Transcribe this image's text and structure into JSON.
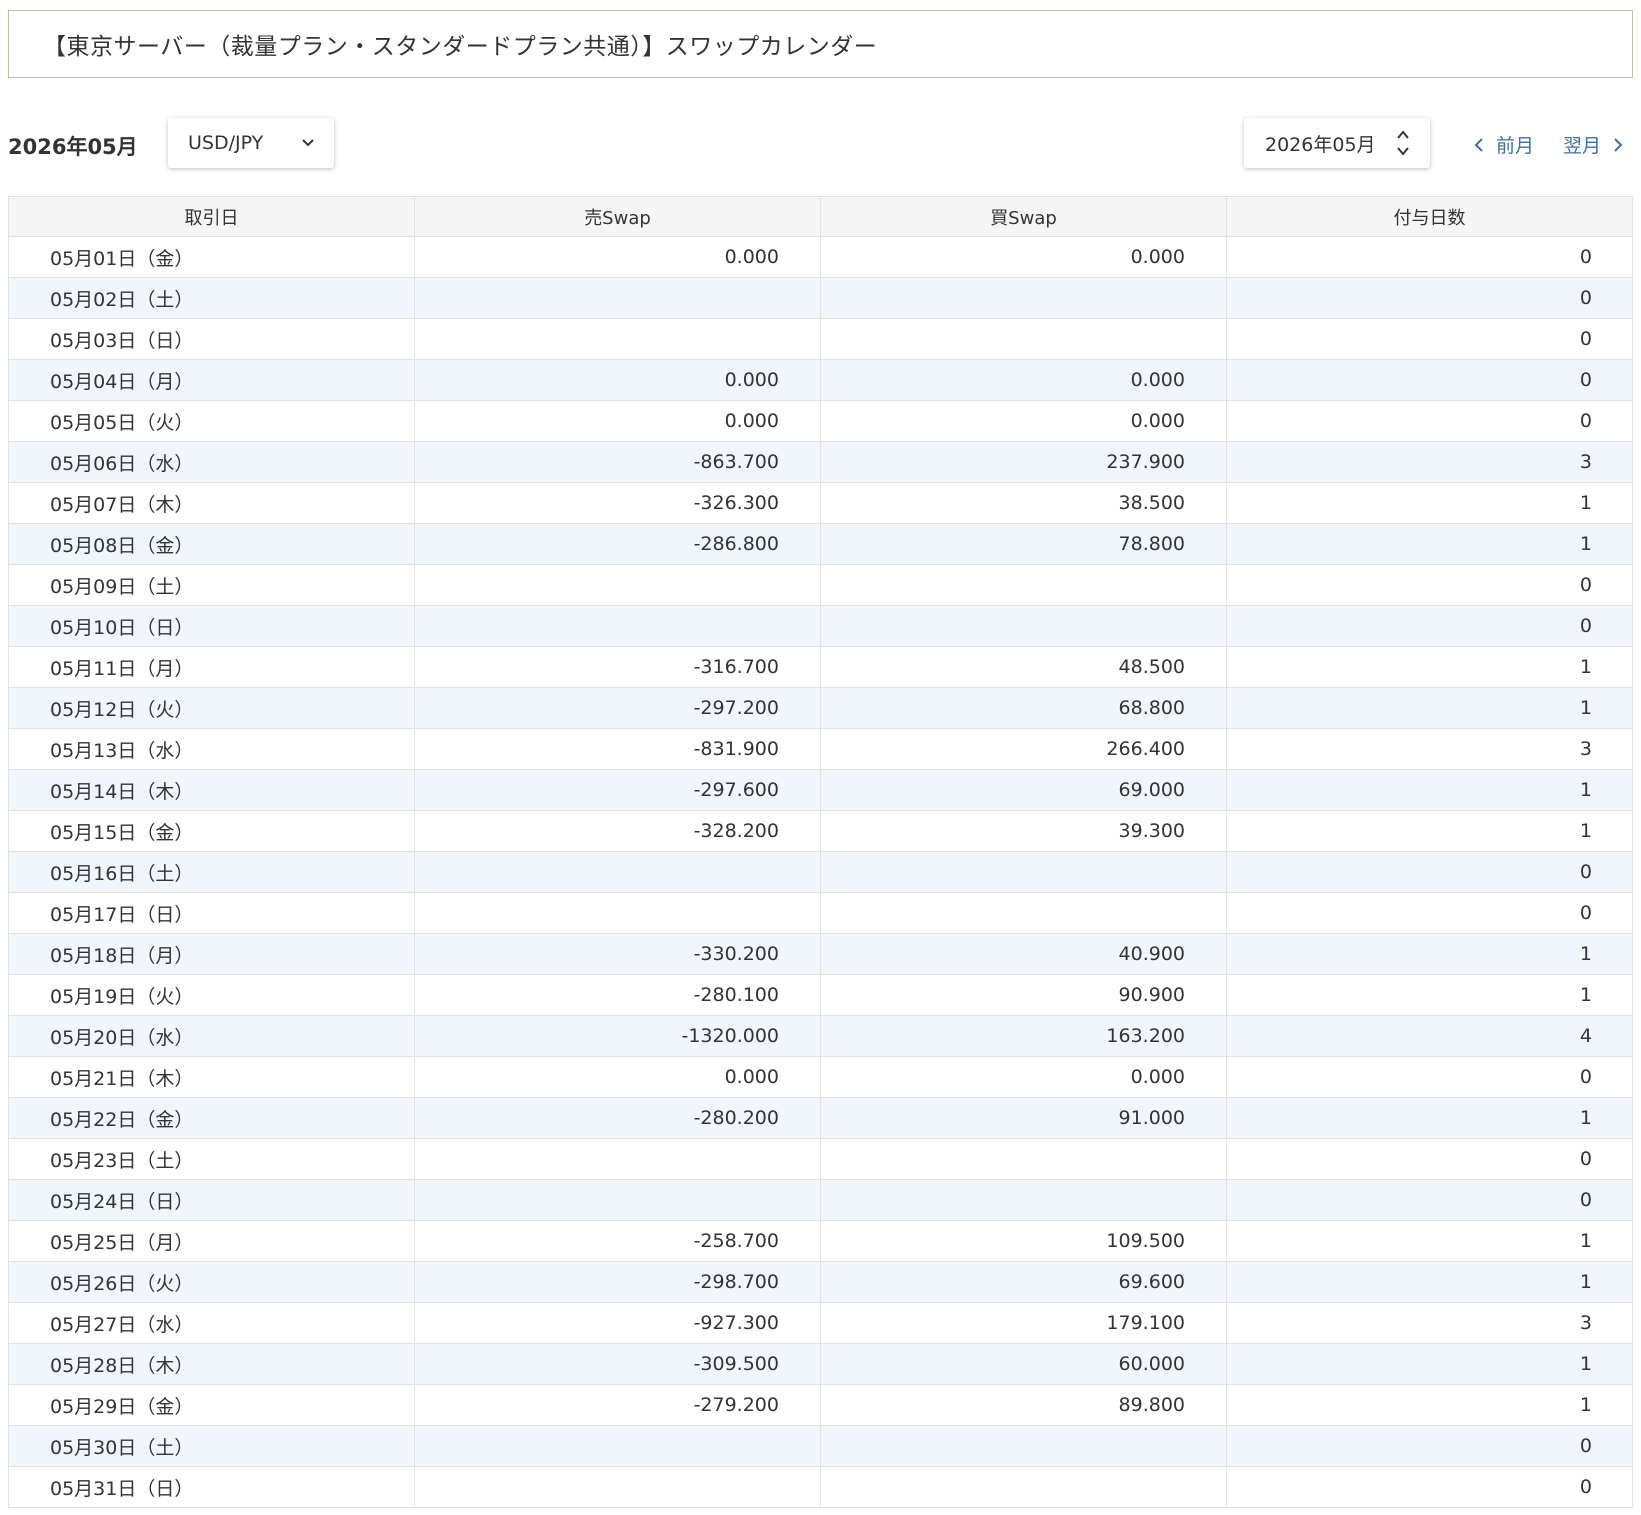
{
  "title": "【東京サーバー（裁量プラン・スタンダードプラン共通）】スワップカレンダー",
  "toolbar": {
    "month_label": "2026年05月",
    "pair_selected": "USD/JPY",
    "month_selected": "2026年05月",
    "prev_label": "前月",
    "next_label": "翌月"
  },
  "icons": {
    "pair_select": "chevron-down-icon",
    "month_select": "up-down-chevron-icon",
    "prev": "chevron-left-icon",
    "next": "chevron-right-icon"
  },
  "colors": {
    "title_border": "#b9c0a3",
    "header_bg": "#f5f5f5",
    "alt_row_bg": "#f1f6fc",
    "link": "#3f6f9f"
  },
  "table": {
    "headers": [
      "取引日",
      "売Swap",
      "買Swap",
      "付与日数"
    ],
    "rows": [
      {
        "date": "05月01日（金）",
        "sell": "0.000",
        "buy": "0.000",
        "days": "0"
      },
      {
        "date": "05月02日（土）",
        "sell": "",
        "buy": "",
        "days": "0"
      },
      {
        "date": "05月03日（日）",
        "sell": "",
        "buy": "",
        "days": "0"
      },
      {
        "date": "05月04日（月）",
        "sell": "0.000",
        "buy": "0.000",
        "days": "0"
      },
      {
        "date": "05月05日（火）",
        "sell": "0.000",
        "buy": "0.000",
        "days": "0"
      },
      {
        "date": "05月06日（水）",
        "sell": "-863.700",
        "buy": "237.900",
        "days": "3"
      },
      {
        "date": "05月07日（木）",
        "sell": "-326.300",
        "buy": "38.500",
        "days": "1"
      },
      {
        "date": "05月08日（金）",
        "sell": "-286.800",
        "buy": "78.800",
        "days": "1"
      },
      {
        "date": "05月09日（土）",
        "sell": "",
        "buy": "",
        "days": "0"
      },
      {
        "date": "05月10日（日）",
        "sell": "",
        "buy": "",
        "days": "0"
      },
      {
        "date": "05月11日（月）",
        "sell": "-316.700",
        "buy": "48.500",
        "days": "1"
      },
      {
        "date": "05月12日（火）",
        "sell": "-297.200",
        "buy": "68.800",
        "days": "1"
      },
      {
        "date": "05月13日（水）",
        "sell": "-831.900",
        "buy": "266.400",
        "days": "3"
      },
      {
        "date": "05月14日（木）",
        "sell": "-297.600",
        "buy": "69.000",
        "days": "1"
      },
      {
        "date": "05月15日（金）",
        "sell": "-328.200",
        "buy": "39.300",
        "days": "1"
      },
      {
        "date": "05月16日（土）",
        "sell": "",
        "buy": "",
        "days": "0"
      },
      {
        "date": "05月17日（日）",
        "sell": "",
        "buy": "",
        "days": "0"
      },
      {
        "date": "05月18日（月）",
        "sell": "-330.200",
        "buy": "40.900",
        "days": "1"
      },
      {
        "date": "05月19日（火）",
        "sell": "-280.100",
        "buy": "90.900",
        "days": "1"
      },
      {
        "date": "05月20日（水）",
        "sell": "-1320.000",
        "buy": "163.200",
        "days": "4"
      },
      {
        "date": "05月21日（木）",
        "sell": "0.000",
        "buy": "0.000",
        "days": "0"
      },
      {
        "date": "05月22日（金）",
        "sell": "-280.200",
        "buy": "91.000",
        "days": "1"
      },
      {
        "date": "05月23日（土）",
        "sell": "",
        "buy": "",
        "days": "0"
      },
      {
        "date": "05月24日（日）",
        "sell": "",
        "buy": "",
        "days": "0"
      },
      {
        "date": "05月25日（月）",
        "sell": "-258.700",
        "buy": "109.500",
        "days": "1"
      },
      {
        "date": "05月26日（火）",
        "sell": "-298.700",
        "buy": "69.600",
        "days": "1"
      },
      {
        "date": "05月27日（水）",
        "sell": "-927.300",
        "buy": "179.100",
        "days": "3"
      },
      {
        "date": "05月28日（木）",
        "sell": "-309.500",
        "buy": "60.000",
        "days": "1"
      },
      {
        "date": "05月29日（金）",
        "sell": "-279.200",
        "buy": "89.800",
        "days": "1"
      },
      {
        "date": "05月30日（土）",
        "sell": "",
        "buy": "",
        "days": "0"
      },
      {
        "date": "05月31日（日）",
        "sell": "",
        "buy": "",
        "days": "0"
      }
    ]
  }
}
